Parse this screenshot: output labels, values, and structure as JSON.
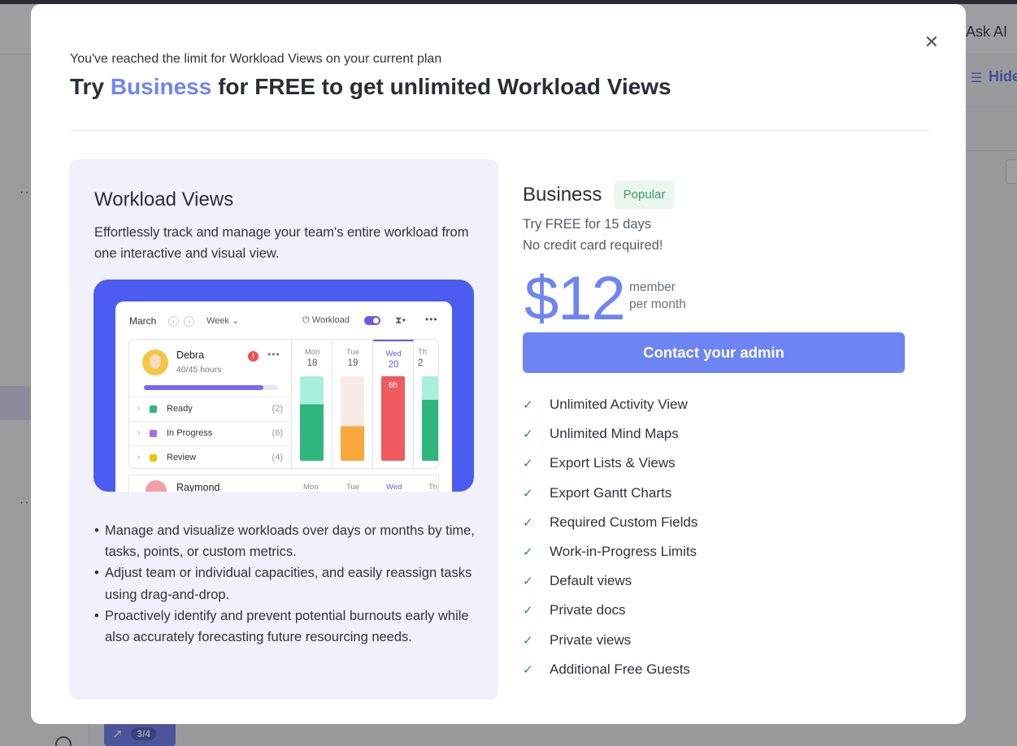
{
  "background": {
    "ask_ai": "Ask AI",
    "hide_label": "Hide",
    "badge_count": "3/4"
  },
  "modal": {
    "limit_text": "You've reached the limit for Workload Views on your current plan",
    "headline_prefix": "Try ",
    "headline_accent": "Business",
    "headline_suffix": " for FREE to get unlimited Workload Views",
    "close_icon": "close-icon"
  },
  "feature": {
    "title": "Workload Views",
    "description": "Effortlessly track and manage your team's entire workload from one interactive and visual view.",
    "bullets": [
      "Manage and visualize workloads over days or months by time, tasks, points, or custom metrics.",
      "Adjust team or individual capacities, and easily reassign tasks using drag-and-drop.",
      "Proactively identify and prevent potential burnouts early while also accurately forecasting future resourcing needs."
    ],
    "preview": {
      "month": "March",
      "range": "Week",
      "view_toggle_label": "Workload",
      "user": {
        "name": "Debra",
        "hours": "40/45 hours",
        "capacity_fraction": 0.89
      },
      "statuses": [
        {
          "label": "Ready",
          "count": "(2)",
          "color": "#2fb67c"
        },
        {
          "label": "In Progress",
          "count": "(6)",
          "color": "#a66cf0"
        },
        {
          "label": "Review",
          "count": "(4)",
          "color": "#f2c300"
        }
      ],
      "days": [
        {
          "name": "Mon",
          "num": "18",
          "active": false
        },
        {
          "name": "Tue",
          "num": "19",
          "active": false
        },
        {
          "name": "Wed",
          "num": "20",
          "active": true,
          "bar_label": "6h"
        },
        {
          "name": "Th",
          "num": "2",
          "active": false
        }
      ],
      "next_user": "Raymond"
    }
  },
  "plan": {
    "name": "Business",
    "badge": "Popular",
    "trial": "Try FREE for 15 days",
    "no_card": "No credit card required!",
    "price": "$12",
    "unit_line1": "member",
    "unit_line2": "per month",
    "cta": "Contact your admin",
    "features": [
      "Unlimited Activity View",
      "Unlimited Mind Maps",
      "Export Lists & Views",
      "Export Gantt Charts",
      "Required Custom Fields",
      "Work-in-Progress Limits",
      "Default views",
      "Private docs",
      "Private views",
      "Additional Free Guests"
    ]
  },
  "colors": {
    "accent": "#6d85f4",
    "check": "#2e8b57",
    "popular_bg": "#e9f7ee",
    "preview_bg": "#4c5cf0"
  }
}
